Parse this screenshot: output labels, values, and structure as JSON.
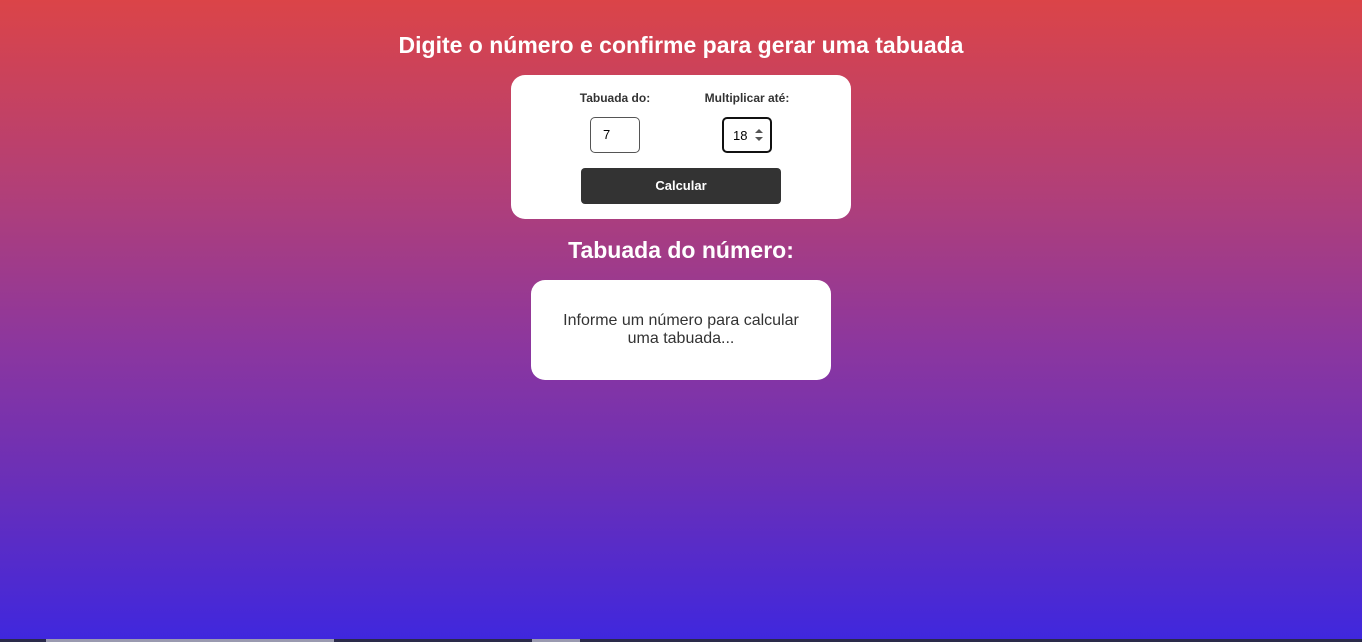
{
  "header": {
    "title": "Digite o número e confirme para gerar uma tabuada"
  },
  "form": {
    "tabuada_label": "Tabuada do:",
    "tabuada_value": "7",
    "multiplicar_label": "Multiplicar até:",
    "multiplicar_value": "18",
    "submit_label": "Calcular"
  },
  "result": {
    "title": "Tabuada do número:",
    "message": "Informe um número para calcular uma tabuada..."
  },
  "icons": {
    "spinner": "spinner-arrows-icon"
  },
  "colors": {
    "gradient_top": "#db4448",
    "gradient_bottom": "#3f27de",
    "button": "#333333",
    "card": "#ffffff"
  }
}
